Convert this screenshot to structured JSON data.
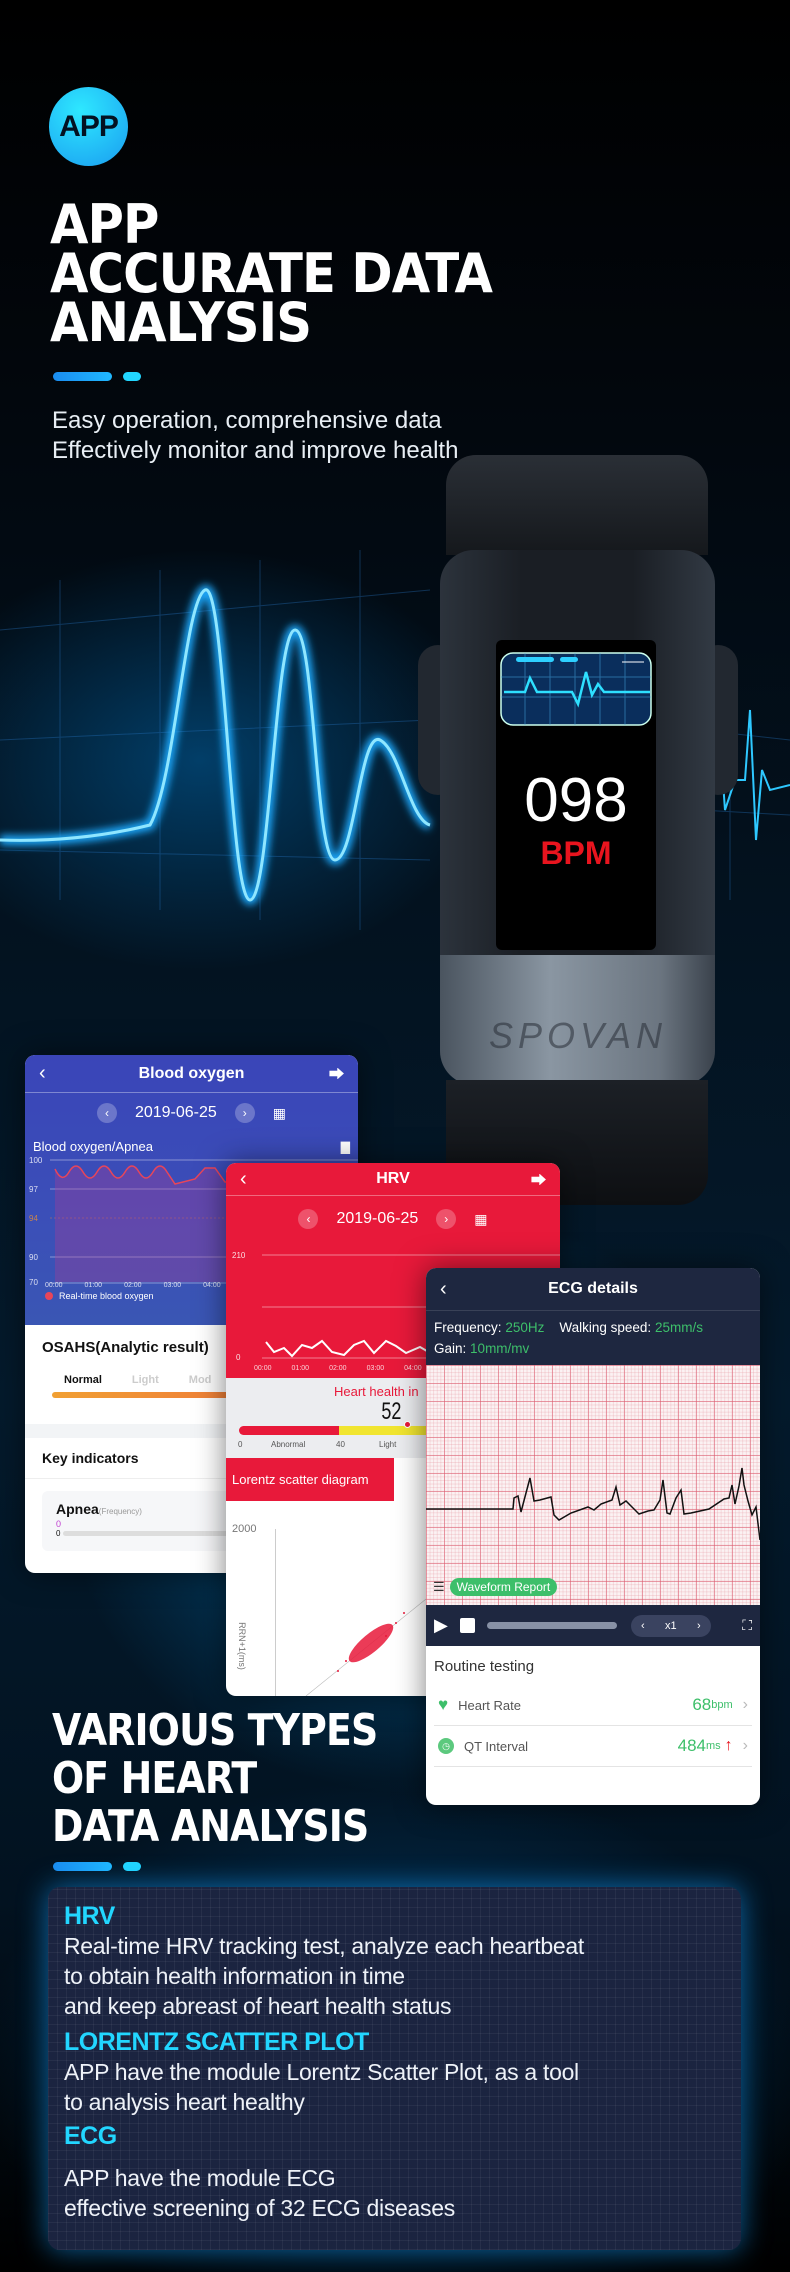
{
  "hero": {
    "badge": "APP",
    "title_lines": [
      "APP",
      "ACCURATE DATA",
      "ANALYSIS"
    ],
    "subtitle_lines": [
      "Easy operation, comprehensive data",
      "Effectively monitor and improve health"
    ]
  },
  "watch": {
    "bpm_value": "098",
    "bpm_unit": "BPM",
    "brand": "SPOVAN"
  },
  "blood_oxygen": {
    "title": "Blood oxygen",
    "date": "2019-06-25",
    "chart_title": "Blood oxygen/Apnea",
    "y_ticks": [
      "100",
      "97",
      "94",
      "90",
      "70"
    ],
    "x_ticks": [
      "00:00",
      "01:00",
      "02:00",
      "03:00",
      "04:00"
    ],
    "legend": "Real-time blood oxygen",
    "osahs_title": "OSAHS(Analytic result)",
    "levels": [
      "Normal",
      "Light",
      "Mod"
    ],
    "key_indicators": "Key indicators",
    "apnea_label": "Apnea",
    "apnea_unit": "(Frequency)",
    "apnea_value": "0",
    "apnea_axis_zero": "0"
  },
  "hrv": {
    "title": "HRV",
    "date": "2019-06-25",
    "y_ticks": [
      "210",
      "0"
    ],
    "x_ticks": [
      "00:00",
      "01:00",
      "02:00",
      "03:00",
      "04:00"
    ],
    "heart_health_label": "Heart health in",
    "heart_health_value": "52",
    "scale_labels": [
      "0",
      "Abnormal",
      "40",
      "Light"
    ],
    "lorentz_tab": "Lorentz scatter diagram",
    "scatter_y_tick": "2000",
    "scatter_y_label": "RRN+1(ms)"
  },
  "ecg": {
    "title": "ECG details",
    "frequency_label": "Frequency:",
    "frequency_value": "250Hz",
    "speed_label": "Walking speed:",
    "speed_value": "25mm/s",
    "gain_label": "Gain:",
    "gain_value": "10mm/mv",
    "waveform_report": "Waveform Report",
    "speed_multiplier": "x1",
    "routine_title": "Routine testing",
    "items": [
      {
        "label": "Heart Rate",
        "value": "68",
        "unit": "bpm"
      },
      {
        "label": "QT Interval",
        "value": "484",
        "unit": "ms"
      }
    ],
    "accent": "#3dbf6a"
  },
  "section2": {
    "title_lines": [
      "VARIOUS TYPES",
      "OF HEART",
      "DATA ANALYSIS"
    ]
  },
  "features": [
    {
      "heading": "HRV",
      "lines": [
        "Real-time HRV tracking test, analyze each heartbeat",
        "to obtain health information in time",
        "and keep abreast of heart health status"
      ]
    },
    {
      "heading": "LORENTZ SCATTER PLOT",
      "lines": [
        "APP have the module Lorentz Scatter Plot, as a tool",
        "to analysis heart healthy"
      ]
    },
    {
      "heading": "ECG",
      "lines": [
        "APP have the module ECG",
        "effective screening of 32 ECG diseases"
      ]
    }
  ],
  "colors": {
    "cyan": "#22d6ff",
    "hrv_red": "#e8193a",
    "blood_blue": "#3a45b8",
    "ecg_navy": "#1e2740"
  }
}
